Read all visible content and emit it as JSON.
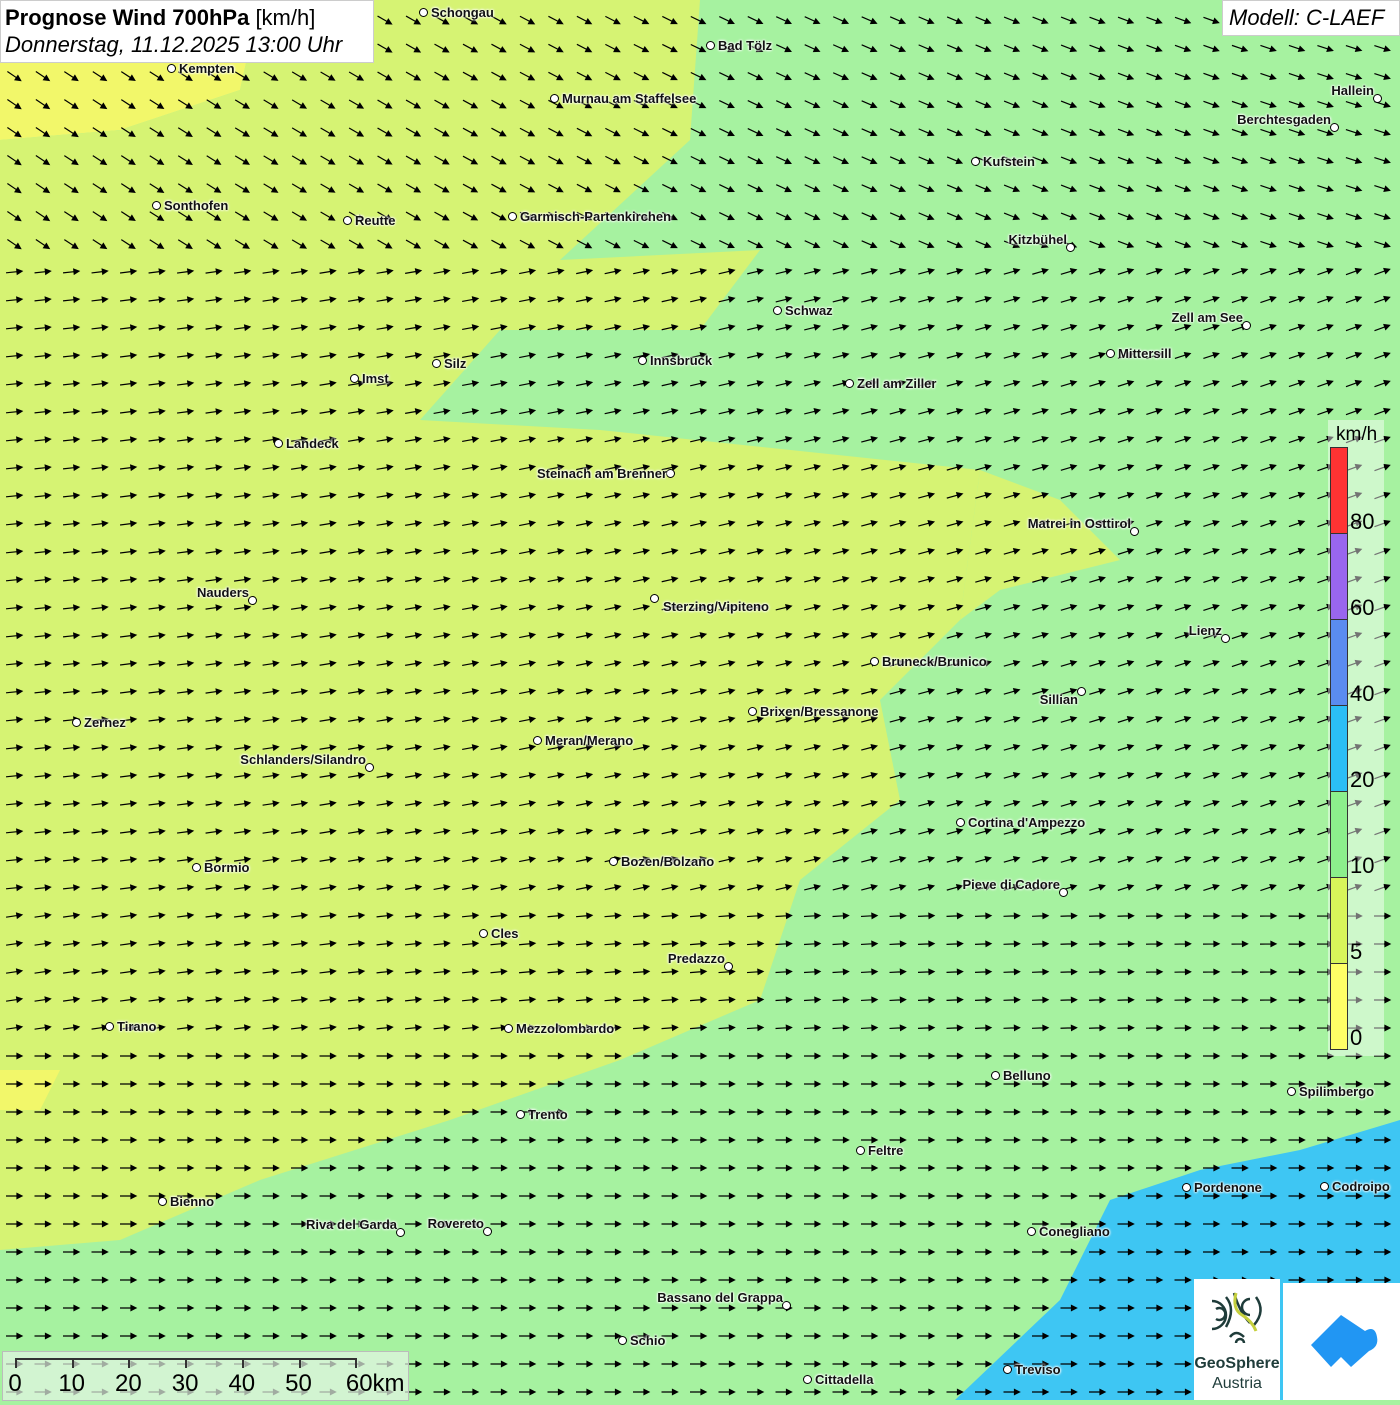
{
  "header": {
    "title_bold": "Prognose Wind 700hPa",
    "title_unit": "[km/h]",
    "datetime": "Donnerstag, 11.12.2025 13:00 Uhr",
    "model": "Modell: C-LAEF"
  },
  "legend": {
    "unit": "km/h",
    "bins": [
      {
        "label": "0",
        "color": "#ffff66"
      },
      {
        "label": "5",
        "color": "#d8f55a"
      },
      {
        "label": "10",
        "color": "#8cef8c"
      },
      {
        "label": "20",
        "color": "#2bbef5"
      },
      {
        "label": "40",
        "color": "#5a8cf0"
      },
      {
        "label": "60",
        "color": "#9966ee"
      },
      {
        "label": "80",
        "color": "#ff3333"
      }
    ]
  },
  "scale_bar": {
    "labels": [
      "0",
      "10",
      "20",
      "30",
      "40",
      "50",
      "60km"
    ]
  },
  "logos": {
    "geosphere_line1": "GeoSphere",
    "geosphere_line2": "Austria"
  },
  "cities": [
    "Schongau",
    "Bad Tölz",
    "Kempten",
    "Murnau am Staffelsee",
    "Hallein",
    "Berchtesgaden",
    "Kufstein",
    "Sonthofen",
    "Reutte",
    "Garmisch-Partenkirchen",
    "Kitzbühel",
    "Schwaz",
    "Zell am See",
    "Mittersill",
    "Innsbruck",
    "Silz",
    "Imst",
    "Zell am Ziller",
    "Landeck",
    "Steinach am Brenner",
    "Matrei in Osttirol",
    "Nauders",
    "Sterzing/Vipiteno",
    "Lienz",
    "Bruneck/Brunico",
    "Sillian",
    "Zernez",
    "Brixen/Bressanone",
    "Meran/Merano",
    "Schlanders/Silandro",
    "Cortina d'Ampezzo",
    "Bozen/Bolzano",
    "Bormio",
    "Pieve di Cadore",
    "Cles",
    "Predazzo",
    "Tirano",
    "Mezzolombardo",
    "Belluno",
    "Spilimbergo",
    "Trento",
    "Feltre",
    "Pordenone",
    "Codroipo",
    "Bienno",
    "Riva del Garda",
    "Rovereto",
    "Conegliano",
    "Bassano del Grappa",
    "Schio",
    "Treviso",
    "Cittadella"
  ]
}
